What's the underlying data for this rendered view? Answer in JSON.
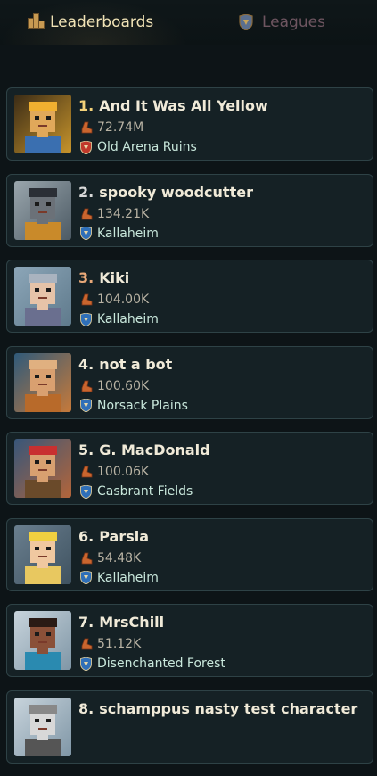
{
  "tabs": [
    {
      "label": "Leaderboards",
      "icon": "trophy-icon",
      "active": true
    },
    {
      "label": "Leagues",
      "icon": "shield-icon",
      "active": false
    }
  ],
  "entries": [
    {
      "rank": "1.",
      "name": "And It Was All Yellow",
      "score": "72.74M",
      "league": "Old Arena Ruins",
      "league_color": "#c0392b",
      "medal": "gold"
    },
    {
      "rank": "2.",
      "name": "spooky woodcutter",
      "score": "134.21K",
      "league": "Kallaheim",
      "league_color": "#2f6fb8",
      "medal": "silver"
    },
    {
      "rank": "3.",
      "name": "Kiki",
      "score": "104.00K",
      "league": "Kallaheim",
      "league_color": "#2f6fb8",
      "medal": "bronze"
    },
    {
      "rank": "4.",
      "name": "not a bot",
      "score": "100.60K",
      "league": "Norsack Plains",
      "league_color": "#2f6fb8",
      "medal": "none"
    },
    {
      "rank": "5.",
      "name": "G. MacDonald",
      "score": "100.06K",
      "league": "Casbrant Fields",
      "league_color": "#2f6fb8",
      "medal": "none"
    },
    {
      "rank": "6.",
      "name": "Parsla",
      "score": "54.48K",
      "league": "Kallaheim",
      "league_color": "#2f6fb8",
      "medal": "none"
    },
    {
      "rank": "7.",
      "name": "MrsChill",
      "score": "51.12K",
      "league": "Disenchanted Forest",
      "league_color": "#2f6fb8",
      "medal": "none"
    },
    {
      "rank": "8.",
      "name": "schamppus nasty test character",
      "score": "",
      "league": "",
      "league_color": "#2f6fb8",
      "medal": "none"
    }
  ],
  "colors": {
    "accent": "#f1e3b6",
    "inactive_tab": "#6e5560",
    "card_bg": "#152125",
    "card_border": "#2e4246"
  }
}
